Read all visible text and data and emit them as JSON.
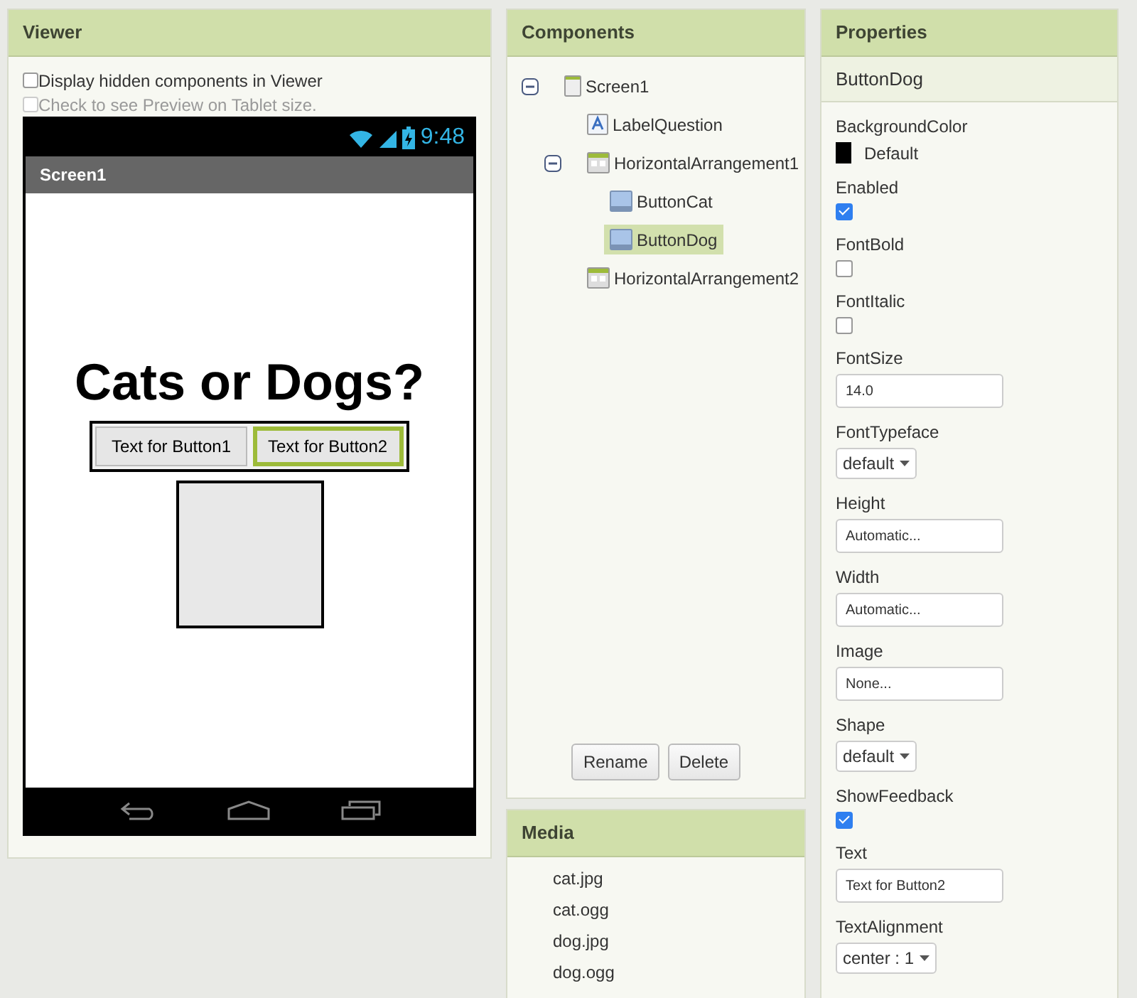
{
  "viewer": {
    "title": "Viewer",
    "options": [
      {
        "label": "Display hidden components in Viewer",
        "checked": false,
        "disabled": false
      },
      {
        "label": "Check to see Preview on Tablet size.",
        "checked": false,
        "disabled": true
      }
    ],
    "phone": {
      "time": "9:48",
      "screen_title": "Screen1",
      "heading": "Cats or Dogs?",
      "buttons": [
        {
          "label": "Text for Button1",
          "selected": false
        },
        {
          "label": "Text for Button2",
          "selected": true
        }
      ]
    }
  },
  "components": {
    "title": "Components",
    "tree": [
      {
        "name": "Screen1",
        "kind": "screen",
        "expanded": true,
        "selected": false,
        "children": [
          {
            "name": "LabelQuestion",
            "kind": "label",
            "selected": false
          },
          {
            "name": "HorizontalArrangement1",
            "kind": "arrangement",
            "expanded": true,
            "selected": false,
            "children": [
              {
                "name": "ButtonCat",
                "kind": "button",
                "selected": false
              },
              {
                "name": "ButtonDog",
                "kind": "button",
                "selected": true
              }
            ]
          },
          {
            "name": "HorizontalArrangement2",
            "kind": "arrangement",
            "selected": false
          }
        ]
      }
    ],
    "buttons": [
      "Rename",
      "Delete"
    ]
  },
  "media": {
    "title": "Media",
    "files": [
      "cat.jpg",
      "cat.ogg",
      "dog.jpg",
      "dog.ogg"
    ]
  },
  "properties": {
    "title": "Properties",
    "component": "ButtonDog",
    "items": [
      {
        "label": "BackgroundColor",
        "kind": "color",
        "value": "Default",
        "color": "#000000"
      },
      {
        "label": "Enabled",
        "kind": "checkbox",
        "checked": true
      },
      {
        "label": "FontBold",
        "kind": "checkbox",
        "checked": false
      },
      {
        "label": "FontItalic",
        "kind": "checkbox",
        "checked": false
      },
      {
        "label": "FontSize",
        "kind": "text",
        "value": "14.0"
      },
      {
        "label": "FontTypeface",
        "kind": "dropdown",
        "value": "default"
      },
      {
        "label": "Height",
        "kind": "text",
        "value": "Automatic..."
      },
      {
        "label": "Width",
        "kind": "text",
        "value": "Automatic..."
      },
      {
        "label": "Image",
        "kind": "text",
        "value": "None..."
      },
      {
        "label": "Shape",
        "kind": "dropdown",
        "value": "default"
      },
      {
        "label": "ShowFeedback",
        "kind": "checkbox",
        "checked": true
      },
      {
        "label": "Text",
        "kind": "text",
        "value": "Text for Button2"
      },
      {
        "label": "TextAlignment",
        "kind": "dropdown",
        "value": "center : 1"
      }
    ]
  }
}
